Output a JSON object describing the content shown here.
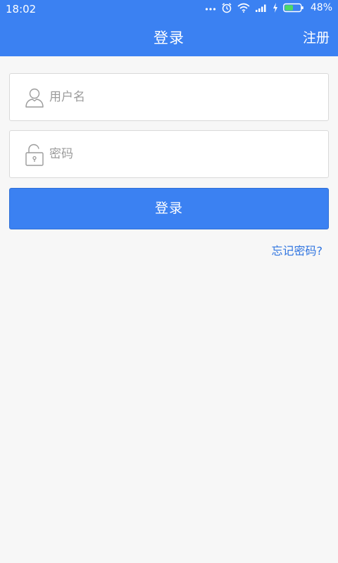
{
  "status_bar": {
    "time": "18:02",
    "battery": "48%",
    "icons": [
      "more-dots-icon",
      "alarm-icon",
      "wifi-icon",
      "signal-icon",
      "charging-icon",
      "battery-icon"
    ]
  },
  "header": {
    "title": "登录",
    "register_label": "注册"
  },
  "form": {
    "username": {
      "value": "",
      "placeholder": "用户名",
      "icon": "user-icon"
    },
    "password": {
      "value": "",
      "placeholder": "密码",
      "icon": "lock-icon"
    },
    "login_label": "登录",
    "forgot_label": "忘记密码?"
  },
  "colors": {
    "accent": "#3b81f2",
    "background": "#f7f7f7",
    "link": "#2f74e0"
  }
}
